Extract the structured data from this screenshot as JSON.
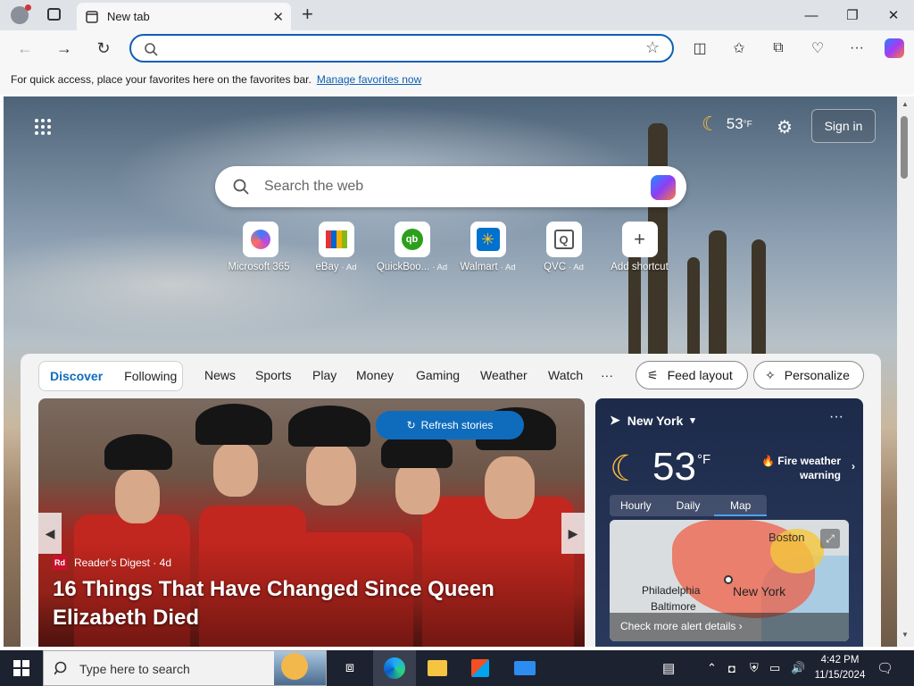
{
  "browser": {
    "tab_title": "New tab",
    "address_value": "",
    "address_placeholder": "",
    "favorites_bar": {
      "message": "For quick access, place your favorites here on the favorites bar.",
      "link": "Manage favorites now"
    }
  },
  "newtab": {
    "weather_temp": "53",
    "weather_unit": "°F",
    "signin": "Sign in",
    "search_placeholder": "Search the web",
    "shortcuts": [
      {
        "label": "Microsoft 365",
        "ad": ""
      },
      {
        "label": "eBay",
        "ad": "· Ad"
      },
      {
        "label": "QuickBoo...",
        "ad": "· Ad"
      },
      {
        "label": "Walmart",
        "ad": "· Ad"
      },
      {
        "label": "QVC",
        "ad": "· Ad"
      },
      {
        "label": "Add shortcut",
        "ad": ""
      }
    ],
    "feed_tabs": [
      "Discover",
      "Following"
    ],
    "nav_tabs": [
      "News",
      "Sports",
      "Play",
      "Money",
      "Gaming",
      "Weather",
      "Watch"
    ],
    "more": "···",
    "feed_layout": "Feed layout",
    "personalize": "Personalize",
    "refresh": "Refresh stories",
    "story": {
      "source": "Reader's Digest · 4d",
      "source_logo": "Rd",
      "headline": "16 Things That Have Changed Since Queen Elizabeth Died"
    },
    "weather_card": {
      "location": "New York",
      "temp": "53",
      "unit": "°F",
      "warning_line1": "Fire weather",
      "warning_line2": "warning",
      "tabs": [
        "Hourly",
        "Daily",
        "Map"
      ],
      "map_labels": [
        "Boston",
        "Philadelphia",
        "New York",
        "Baltimore"
      ],
      "map_link": "Check more alert details"
    }
  },
  "taskbar": {
    "search_placeholder": "Type here to search",
    "time": "4:42 PM",
    "date": "11/15/2024"
  },
  "colors": {
    "accent": "#0f6cbd",
    "address_border": "#0f5fb5",
    "taskbar": "#1d2230"
  }
}
